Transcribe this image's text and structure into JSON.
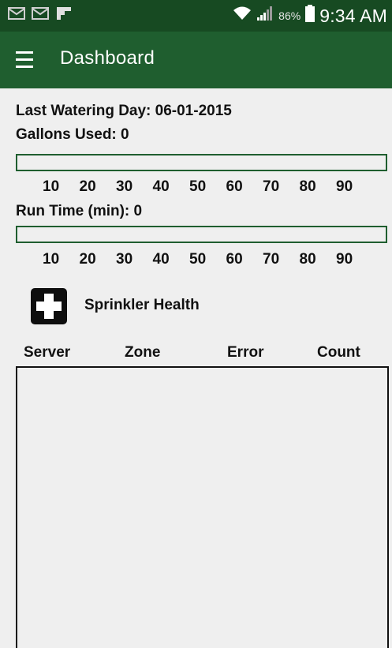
{
  "status_bar": {
    "icons": [
      "email-icon",
      "email-icon",
      "flipboard-icon",
      "wifi-icon",
      "signal-icon",
      "battery-icon"
    ],
    "battery_percent": "86%",
    "time": "9:34 AM"
  },
  "app_bar": {
    "menu_icon": "hamburger-menu-icon",
    "title": "Dashboard"
  },
  "dashboard": {
    "last_watering": "Last Watering Day: 06-01-2015",
    "gallons_used": "Gallons Used: 0",
    "gallons_progress": 0,
    "run_time": "Run Time (min): 0",
    "run_time_progress": 0,
    "scale_ticks": [
      "10",
      "20",
      "30",
      "40",
      "50",
      "60",
      "70",
      "80",
      "90"
    ]
  },
  "sprinkler_health": {
    "icon": "medical-cross-icon",
    "title": "Sprinkler Health",
    "columns": [
      "Server",
      "Zone",
      "Error",
      "Count"
    ],
    "rows": []
  },
  "colors": {
    "status_bar": "#174a22",
    "app_bar": "#1f5e2f",
    "background": "#efefef",
    "progress_border": "#1f5e2f"
  }
}
